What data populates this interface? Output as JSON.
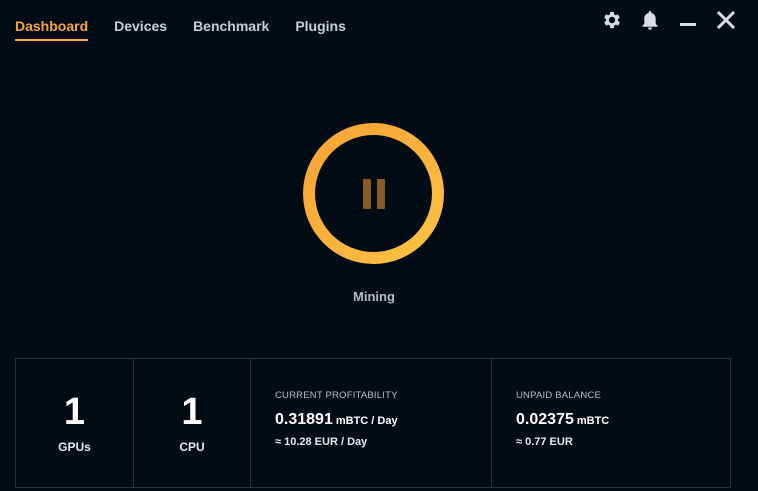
{
  "nav": {
    "tabs": [
      {
        "label": "Dashboard",
        "active": true
      },
      {
        "label": "Devices",
        "active": false
      },
      {
        "label": "Benchmark",
        "active": false
      },
      {
        "label": "Plugins",
        "active": false
      }
    ]
  },
  "window_controls": [
    "gear-icon",
    "bell-icon",
    "minimize-icon",
    "close-icon"
  ],
  "mining": {
    "status_label": "Mining",
    "button_icon": "pause-icon"
  },
  "stats": {
    "gpus": {
      "count": "1",
      "label": "GPUs"
    },
    "cpu": {
      "count": "1",
      "label": "CPU"
    },
    "profitability": {
      "title": "CURRENT PROFITABILITY",
      "value": "0.31891",
      "unit": "mBTC / Day",
      "fiat": "≈ 10.28 EUR / Day"
    },
    "balance": {
      "title": "UNPAID BALANCE",
      "value": "0.02375",
      "unit": "mBTC",
      "fiat": "≈ 0.77 EUR"
    }
  },
  "colors": {
    "background": "#030c15",
    "accent": "#f5a53a",
    "border": "#2a323b"
  }
}
